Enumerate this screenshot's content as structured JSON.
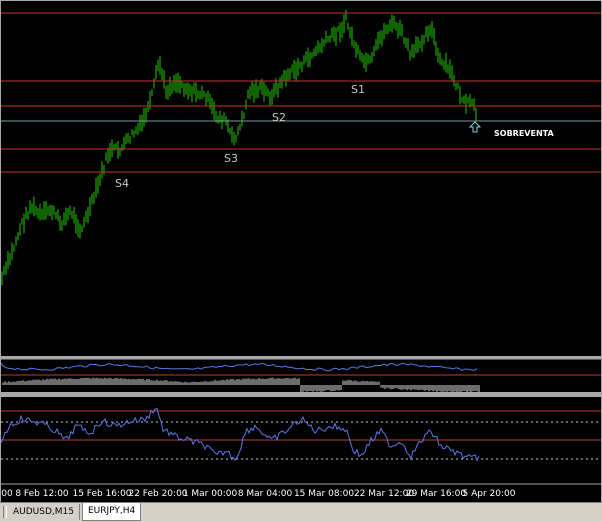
{
  "chart": {
    "symbol": "EURJPY",
    "timeframe": "H4",
    "levels": [
      {
        "label": "S1"
      },
      {
        "label": "S2"
      },
      {
        "label": "S3"
      },
      {
        "label": "S4"
      }
    ],
    "signal_label": "SOBREVENTA",
    "time_labels": [
      "00",
      "8 Feb 12:00",
      "15 Feb 16:00",
      "22 Feb 20:00",
      "1 Mar 00:00",
      "8 Mar 04:00",
      "15 Mar 08:00",
      "22 Mar 12:00",
      "29 Mar 16:00",
      "5 Apr 20:00"
    ],
    "colors": {
      "background": "#000000",
      "candle": "#22c800",
      "level_line": "#c0392b",
      "current_price": "#7f97a0",
      "indicator_line": "#5b78e6",
      "histogram": "#d8d8d8",
      "arrow": "#7fd2e0"
    }
  },
  "tabs": [
    {
      "label": "AUDUSD,M15",
      "active": false
    },
    {
      "label": "EURJPY,H4",
      "active": true
    }
  ]
}
